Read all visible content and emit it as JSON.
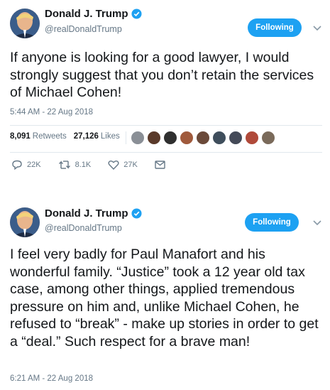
{
  "tweets": [
    {
      "name": "Donald J. Trump",
      "handle": "@realDonaldTrump",
      "follow_label": "Following",
      "text": "If anyone is looking for a good lawyer, I would strongly suggest that you don’t retain the services of Michael Cohen!",
      "timestamp": "5:44 AM - 22 Aug 2018",
      "retweets_count": "8,091",
      "retweets_label": "Retweets",
      "likes_count": "27,126",
      "likes_label": "Likes",
      "reply_count": "22K",
      "retweet_action_count": "8.1K",
      "like_action_count": "27K"
    },
    {
      "name": "Donald J. Trump",
      "handle": "@realDonaldTrump",
      "follow_label": "Following",
      "text": "I feel very badly for Paul Manafort and his wonderful family. “Justice” took a 12 year old tax case, among other things, applied tremendous pressure on him and, unlike Michael Cohen, he refused to “break” - make up stories in order to get a “deal.” Such respect for a brave man!",
      "timestamp": "6:21 AM - 22 Aug 2018"
    }
  ],
  "colors": {
    "accent": "#1da1f2",
    "muted": "#657786",
    "text": "#14171a",
    "border": "#e1e8ed"
  },
  "icons": {
    "verified": "verified-badge-icon",
    "caret": "chevron-down-icon",
    "reply": "reply-icon",
    "retweet": "retweet-icon",
    "like": "heart-icon",
    "dm": "envelope-icon"
  }
}
